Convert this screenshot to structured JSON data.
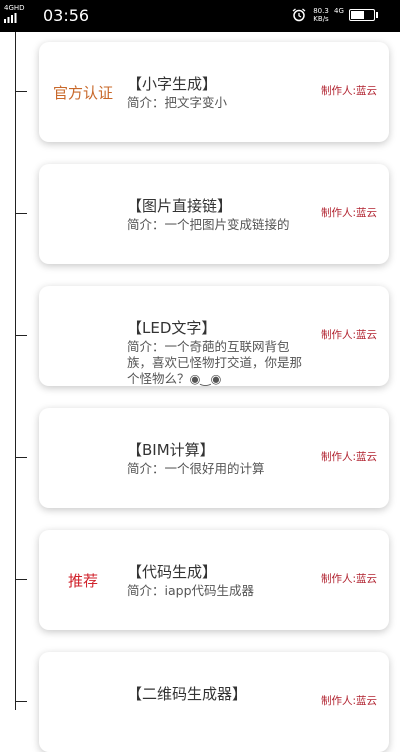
{
  "status_bar": {
    "network_top": "4GHD",
    "time": "03:56",
    "speed_value": "80.3",
    "speed_unit": "KB/s",
    "network_right": "4G",
    "battery": "55"
  },
  "cards": [
    {
      "badge": "官方认证",
      "badge_type": "official",
      "title": "【小字生成】",
      "desc": "简介：把文字变小",
      "author": "制作人:蓝云"
    },
    {
      "badge": "",
      "badge_type": "",
      "title": "【图片直接链】",
      "desc": "简介：一个把图片变成链接的",
      "author": "制作人:蓝云"
    },
    {
      "badge": "",
      "badge_type": "",
      "title": "【LED文字】",
      "desc": "简介：一个奇葩的互联网背包族，喜欢已怪物打交道，你是那个怪物么？◉‿◉",
      "author": "制作人:蓝云"
    },
    {
      "badge": "",
      "badge_type": "",
      "title": "【BIM计算】",
      "desc": "简介：一个很好用的计算",
      "author": "制作人:蓝云"
    },
    {
      "badge": "推荐",
      "badge_type": "recommend",
      "title": "【代码生成】",
      "desc": "简介：iapp代码生成器",
      "author": "制作人:蓝云"
    },
    {
      "badge": "",
      "badge_type": "",
      "title": "【二维码生成器】",
      "desc": "",
      "author": "制作人:蓝云"
    }
  ]
}
